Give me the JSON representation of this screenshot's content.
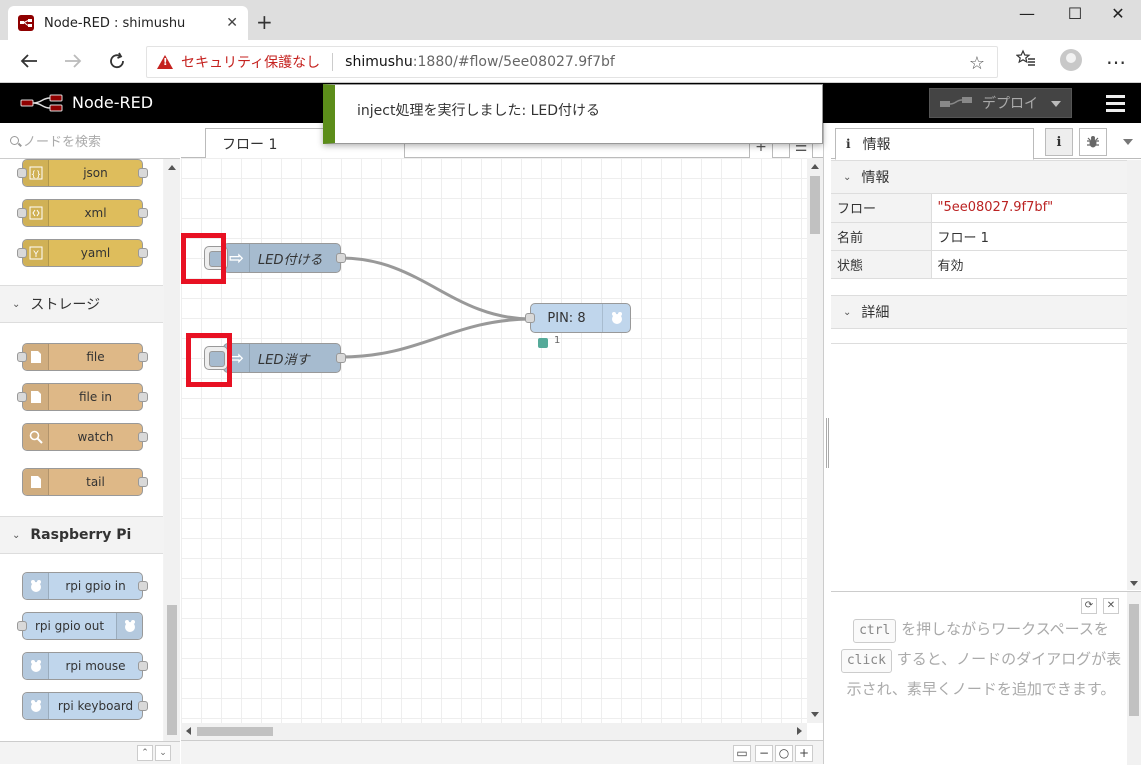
{
  "browser": {
    "tab_title": "Node-RED : shimushu",
    "tab_close": "✕",
    "new_tab": "+",
    "security_label": "セキュリティ保護なし",
    "url_host": "shimushu",
    "url_rest": ":1880/#flow/5ee08027.9f7bf",
    "window_controls": [
      "—",
      "☐",
      "✕"
    ]
  },
  "header": {
    "app_name": "Node-RED",
    "deploy_label": "デプロイ"
  },
  "notification": {
    "message": "inject処理を実行しました: LED付ける"
  },
  "palette": {
    "search_placeholder": "ノードを検索",
    "categories": [
      {
        "name": "ストレージ"
      },
      {
        "name": "Raspberry Pi"
      }
    ],
    "parser_nodes": [
      {
        "label": "json",
        "icon": "{}"
      },
      {
        "label": "xml",
        "icon": "‹›"
      },
      {
        "label": "yaml",
        "icon": "Y"
      }
    ],
    "storage_nodes": [
      {
        "label": "file"
      },
      {
        "label": "file in"
      },
      {
        "label": "watch"
      },
      {
        "label": "tail"
      }
    ],
    "rpi_nodes": [
      {
        "label": "rpi gpio in"
      },
      {
        "label": "rpi gpio out"
      },
      {
        "label": "rpi mouse"
      },
      {
        "label": "rpi keyboard"
      }
    ]
  },
  "workspace": {
    "tab_label": "フロー 1",
    "nodes": {
      "inject_on": "LED付ける",
      "inject_off": "LED消す",
      "gpio_out": "PIN: 8",
      "gpio_status": "1"
    }
  },
  "sidebar": {
    "tab_label": "情報",
    "section_info": "情報",
    "section_detail": "詳細",
    "properties": [
      {
        "key": "フロー",
        "value": "\"5ee08027.9f7bf\""
      },
      {
        "key": "名前",
        "value": "フロー 1"
      },
      {
        "key": "状態",
        "value": "有効"
      }
    ],
    "help": {
      "kbd1": "ctrl",
      "kbd2": "click",
      "text1": "を押しながらワークスペースを",
      "text2": "すると、ノードのダイアログが表示され、素早くノードを追加できます。"
    }
  },
  "colors": {
    "parser": "#debd5c",
    "storage": "#deb887",
    "rpi": "#c0d6ec",
    "inject": "#a6bbcf",
    "highlight": "#e81123",
    "notif_accent": "#5c8d1a"
  }
}
